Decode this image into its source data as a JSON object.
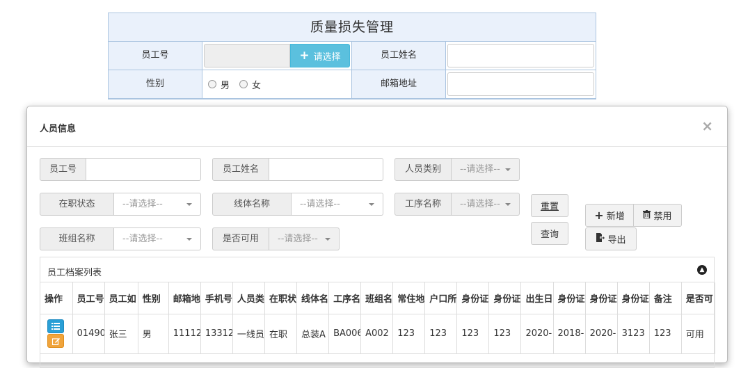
{
  "bg_form": {
    "title": "质量损失管理",
    "rows": [
      {
        "label_left": "员工号",
        "button_label": "请选择",
        "label_right": "员工姓名"
      },
      {
        "label_left": "性别",
        "radio_male": "男",
        "radio_female": "女",
        "label_right": "邮箱地址"
      }
    ]
  },
  "modal": {
    "title": "人员信息",
    "close": "×",
    "filters": {
      "emp_no": "员工号",
      "emp_name": "员工姓名",
      "person_type": "人员类别",
      "job_status": "在职状态",
      "line_name": "线体名称",
      "process_name": "工序名称",
      "team_name": "班组名称",
      "available": "是否可用",
      "placeholder": "--请选择--"
    },
    "buttons": {
      "reset": "重置",
      "query": "查询",
      "add": "新增",
      "disable": "禁用",
      "export": "导出"
    },
    "table": {
      "title": "员工档案列表",
      "headers": [
        "操作",
        "员工号",
        "员工姓名",
        "性别",
        "邮箱地址",
        "手机号",
        "人员类别",
        "在职状态",
        "线体名称",
        "工序名称",
        "班组名称",
        "常住地",
        "户口所在",
        "身份证",
        "身份证",
        "出生日期",
        "身份证",
        "身份证",
        "身份证",
        "备注",
        "是否可用"
      ],
      "headers_display": [
        "操作",
        "员工号",
        "员工如",
        "性别",
        "邮箱地",
        "手机号",
        "人员类",
        "在职状",
        "线体名",
        "工序名",
        "班组名",
        "常住地",
        "户口所",
        "身份证",
        "身份证",
        "出生日",
        "身份证",
        "身份证",
        "身份证",
        "备注",
        "是否可"
      ],
      "rows": [
        [
          "",
          "01490",
          "张三",
          "男",
          "11112",
          "13312",
          "一线员工",
          "在职",
          "总装A",
          "BA006",
          "A002",
          "123",
          "123",
          "123",
          "123",
          "2020-",
          "2018-",
          "2020-",
          "3123",
          "123",
          "可用"
        ]
      ]
    }
  },
  "colors": {
    "info_button": "#5bc0de",
    "header_bg": "#eaf1fb",
    "edit_blue": "#2a9fd6",
    "edit_orange": "#f0a43c"
  }
}
